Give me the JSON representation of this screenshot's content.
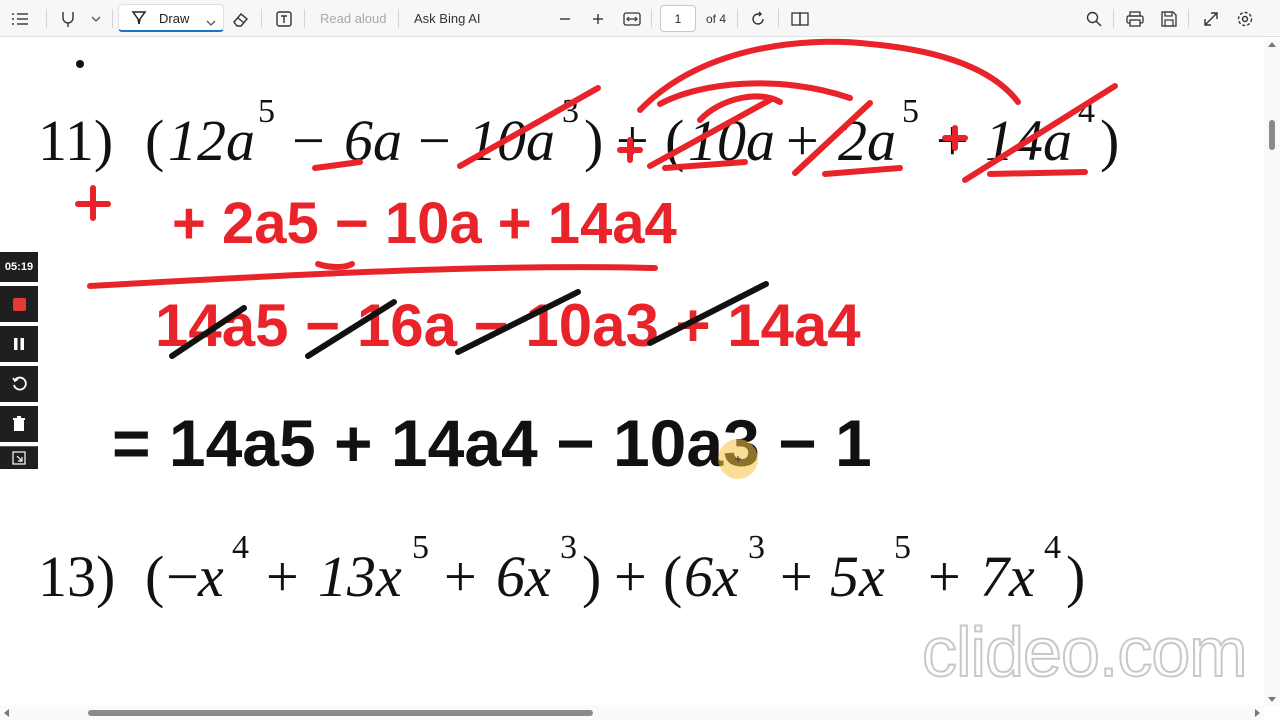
{
  "toolbar": {
    "draw_label": "Draw",
    "read_aloud_label": "Read aloud",
    "ask_bing_label": "Ask Bing AI",
    "page_number": "1",
    "page_total": "of 4",
    "icons": [
      "contents-icon",
      "highlight-icon",
      "chevron-down-icon",
      "pen-icon",
      "eraser-icon",
      "text-box-icon",
      "zoom-out-icon",
      "zoom-in-icon",
      "fit-width-icon",
      "rotate-icon",
      "page-view-icon",
      "search-icon",
      "print-icon",
      "save-icon",
      "fullscreen-icon",
      "settings-icon"
    ]
  },
  "recorder": {
    "timer": "05:19",
    "controls": [
      "stop-icon",
      "pause-icon",
      "restart-icon",
      "delete-icon",
      "collapse-icon"
    ]
  },
  "document": {
    "problem_11": {
      "number": "11)",
      "terms_group1": [
        "12a",
        "5",
        "6a",
        "10a",
        "3"
      ],
      "terms_group2": [
        "10a",
        "2a",
        "5",
        "14a",
        "4"
      ]
    },
    "problem_13": {
      "number": "13)",
      "terms_group1": [
        "x",
        "4",
        "13x",
        "5",
        "6x",
        "3"
      ],
      "terms_group2": [
        "6x",
        "3",
        "5x",
        "5",
        "7x",
        "4"
      ]
    },
    "annotations": {
      "rewrite_line": "+ 2a5 − 10a + 14a4",
      "sum_line": "14a5 − 16a − 10a3 + 14a4",
      "answer_line": "= 14a5 + 14a4 − 10a3 − 1"
    }
  },
  "watermark": "clideo.com",
  "colors": {
    "ink_red": "#e8232a",
    "ink_black": "#111111",
    "accent_blue": "#1a73c8",
    "recorder_bg": "#1f1f1f",
    "stop_red": "#e53935",
    "cursor_yellow": "#f6c343"
  }
}
